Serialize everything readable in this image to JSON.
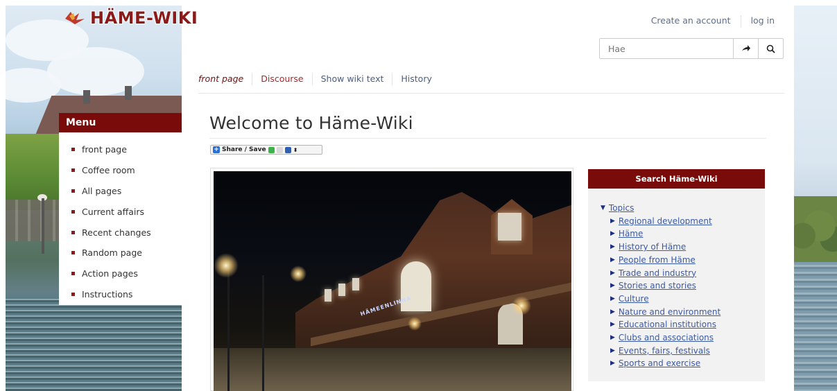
{
  "logo": {
    "text": "HÄME-WIKI"
  },
  "user_links": {
    "create_account": "Create an account",
    "login": "log in"
  },
  "search": {
    "placeholder": "Hae",
    "go_icon": "arrow-right-icon",
    "search_icon": "magnifier-icon"
  },
  "tabs": [
    {
      "label": "front page"
    },
    {
      "label": "Discourse"
    },
    {
      "label": "Show wiki text"
    },
    {
      "label": "History"
    }
  ],
  "menu": {
    "title": "Menu",
    "items": [
      {
        "label": "front page"
      },
      {
        "label": "Coffee room"
      },
      {
        "label": "All pages"
      },
      {
        "label": "Current affairs"
      },
      {
        "label": "Recent changes"
      },
      {
        "label": "Random page"
      },
      {
        "label": "Action pages"
      },
      {
        "label": "Instructions"
      }
    ]
  },
  "page": {
    "title": "Welcome to Häme-Wiki",
    "share_label": "Share / Save",
    "photo_sign": "HÄMEENLINNA"
  },
  "topics_box": {
    "title": "Search Häme-Wiki",
    "root": "Topics",
    "items": [
      "Regional development",
      "Häme",
      "History of Häme",
      "People from Häme",
      "Trade and industry",
      "Stories and stories",
      "Culture",
      "Nature and environment",
      "Educational institutions",
      "Clubs and associations",
      "Events, fairs, festivals",
      "Sports and exercise"
    ]
  },
  "colors": {
    "brand_red": "#7a0b0b",
    "link_blue": "#3a5aa8"
  }
}
